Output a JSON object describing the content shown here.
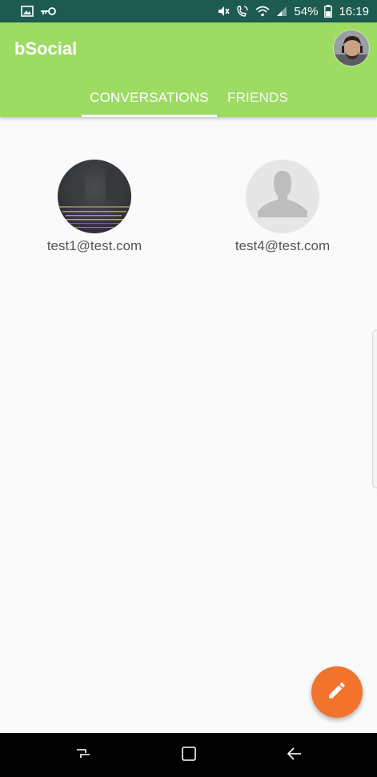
{
  "status_bar": {
    "battery": "54%",
    "time": "16:19",
    "icons": [
      "image-icon",
      "key-icon",
      "mute-icon",
      "wifi-call-icon",
      "wifi-icon",
      "signal-icon",
      "battery-icon"
    ]
  },
  "app_bar": {
    "title": "bSocial",
    "profile_avatar": "profile-avatar"
  },
  "tabs": [
    {
      "label": "CONVERSATIONS",
      "selected": true
    },
    {
      "label": "FRIENDS",
      "selected": false
    }
  ],
  "conversations": [
    {
      "email": "test1@test.com",
      "avatar": "photo"
    },
    {
      "email": "test4@test.com",
      "avatar": "default-person-icon"
    }
  ],
  "fab": {
    "icon": "pencil-icon"
  },
  "nav_bar": {
    "icons": [
      "recent-apps-icon",
      "home-icon",
      "back-icon"
    ]
  },
  "colors": {
    "status_bar": "#1d5b4e",
    "app_bar": "#9ddb63",
    "fab": "#f2742c",
    "background": "#fafafa"
  }
}
